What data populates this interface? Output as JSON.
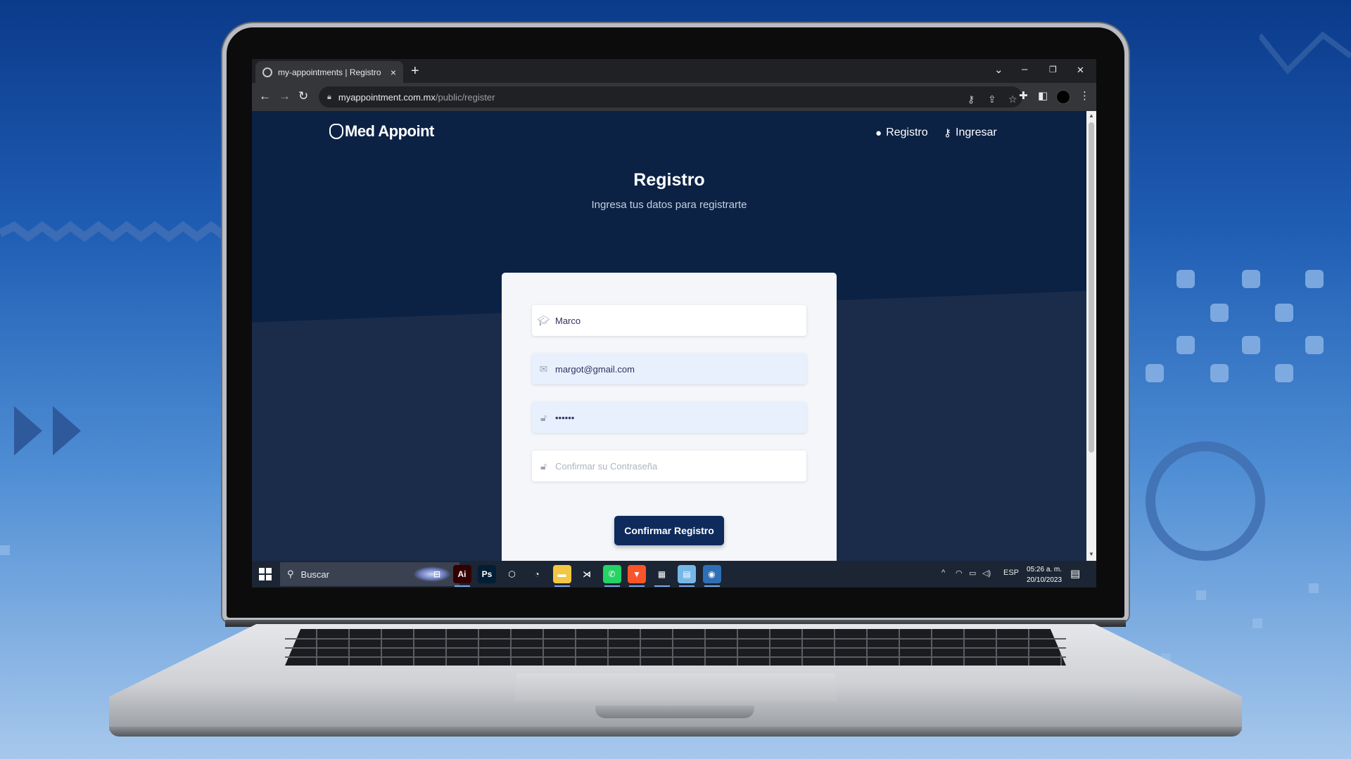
{
  "browser": {
    "tab_title": "my-appointments | Registro",
    "tab_close": "×",
    "new_tab": "+",
    "url_domain": "myappointment.com.mx",
    "url_path": "/public/register",
    "window_controls": [
      "⌄",
      "–",
      "❐",
      "✕"
    ]
  },
  "site": {
    "brand": "Med Appoint",
    "nav": [
      {
        "label": "Registro",
        "icon": "user-circle-icon"
      },
      {
        "label": "Ingresar",
        "icon": "key-icon"
      }
    ],
    "heading": "Registro",
    "subheading": "Ingresa tus datos para registrarte"
  },
  "form": {
    "name_value": "Marco",
    "email_value": "margot@gmail.com",
    "password_value": "••••••",
    "confirm_placeholder": "Confirmar su Contraseña",
    "submit_label": "Confirmar Registro"
  },
  "taskbar": {
    "search_label": "Buscar",
    "language": "ESP",
    "time": "05:26 a. m.",
    "date": "20/10/2023",
    "apps": [
      {
        "name": "task-view",
        "label": "⊟",
        "color": "transparent"
      },
      {
        "name": "illustrator",
        "label": "Ai",
        "color": "#330000"
      },
      {
        "name": "photoshop",
        "label": "Ps",
        "color": "#001e36"
      },
      {
        "name": "unity",
        "label": "⬡",
        "color": "transparent"
      },
      {
        "name": "blender",
        "label": "◔",
        "color": "transparent"
      },
      {
        "name": "file-explorer",
        "label": "▬",
        "color": "#f2c744"
      },
      {
        "name": "vscode",
        "label": "⋊",
        "color": "transparent"
      },
      {
        "name": "whatsapp",
        "label": "✆",
        "color": "#25d366"
      },
      {
        "name": "brave",
        "label": "▼",
        "color": "#fb542b"
      },
      {
        "name": "app-tool",
        "label": "▦",
        "color": "transparent"
      },
      {
        "name": "notepad",
        "label": "▤",
        "color": "#76b7e8"
      },
      {
        "name": "chrome",
        "label": "◉",
        "color": "#2f6fb5"
      }
    ]
  }
}
